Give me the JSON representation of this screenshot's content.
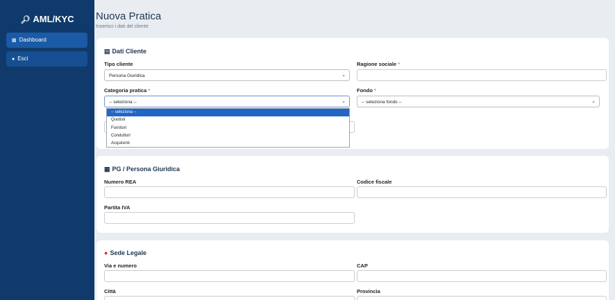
{
  "sidebar": {
    "brand": "AML/KYC",
    "items": [
      {
        "label": "Dashboard",
        "icon": "grid-icon"
      },
      {
        "label": "Esci",
        "icon": "person-icon"
      }
    ]
  },
  "page": {
    "title": "Nuova Pratica",
    "subtitle": "Inserisci i dati del cliente"
  },
  "dati_cliente": {
    "title": "Dati Cliente",
    "tipo_cliente_label": "Tipo cliente",
    "tipo_cliente_value": "Persona Giuridica",
    "ragione_sociale_label": "Ragione sociale",
    "categoria_label": "Categoria pratica",
    "categoria_value": "-- seleziona --",
    "fondo_label": "Fondo",
    "fondo_value": "-- seleziona fondo --",
    "categoria_options": [
      "-- seleziona --",
      "Quotisti",
      "Fornitori",
      "Conduttori",
      "Acquirenti"
    ],
    "required_mark": "*"
  },
  "persona_giuridica": {
    "title": "PG / Persona Giuridica",
    "numero_rea_label": "Numero REA",
    "codice_fiscale_label": "Codice fiscale",
    "partita_iva_label": "Partita IVA"
  },
  "sede_legale": {
    "title": "Sede Legale",
    "via_label": "Via e numero",
    "cap_label": "CAP",
    "citta_label": "Città",
    "provincia_label": "Provincia"
  }
}
